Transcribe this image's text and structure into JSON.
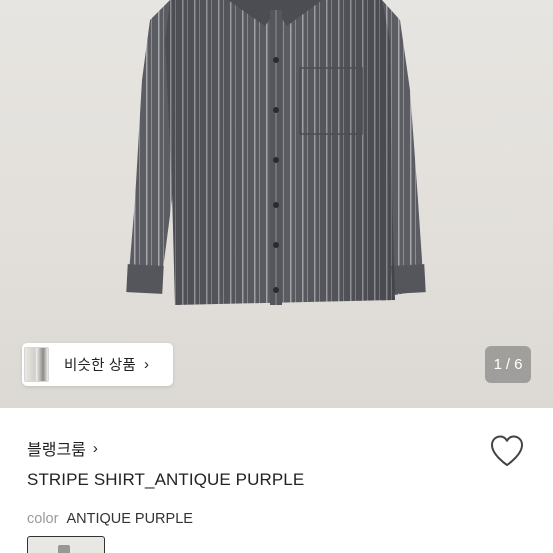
{
  "gallery": {
    "image_alt": "",
    "pager_current": "1",
    "pager_sep": "/",
    "pager_total": "6",
    "similar_button_label": "비슷한 상품",
    "similar_button_chevron": "›"
  },
  "product": {
    "brand": "블랭크룸",
    "brand_chevron": "›",
    "title": "STRIPE SHIRT_ANTIQUE PURPLE",
    "color_key": "color",
    "color_value": "ANTIQUE PURPLE"
  },
  "icons": {
    "wishlist": "heart-outline-icon",
    "similar_thumb": "product-thumbnail"
  },
  "colors": {
    "shirt_base": "#5c5d63",
    "shirt_stripe": "#a3a5ab",
    "background": "#e5e2de",
    "pager_bg": "#7a7a7a"
  }
}
